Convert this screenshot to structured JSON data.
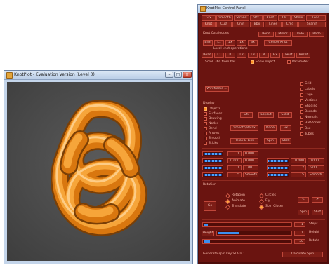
{
  "viewer": {
    "title": "KnotPlot - Evaluation Version (Level 0)",
    "colors": {
      "background": "#4c4c4c",
      "knot": "#e98d1f"
    },
    "controls": [
      "minimize-button",
      "maximize-button",
      "close-button"
    ]
  },
  "panel": {
    "title": "KnotPlot Control Panel",
    "tabs_row1": [
      "Gfx",
      "Smooth",
      "Strand",
      "Vtx",
      "Knot",
      "Clr",
      "Show",
      "Load"
    ],
    "tabs_row2": [
      "Knot",
      "Cust",
      "Cnlit",
      "Bbx",
      "Lines",
      "Cmd",
      "Search"
    ],
    "section_label": "Knot Catalogues",
    "top_buttons": [
      "Bend",
      "Mirror",
      "Undo",
      "Redo"
    ],
    "row_a": [
      "Brm",
      "L1",
      "2x",
      "1x",
      "3x",
      "Center Knot"
    ],
    "row_b_label": "Local knot operations",
    "row_b": [
      "Bead",
      "L1",
      "R",
      "L2",
      "L3",
      "R",
      "Fix",
      "Twist",
      "Reset"
    ],
    "note": "Scroll 360 from bar",
    "check_show_object": "Show object",
    "check_parameter": "Parameter",
    "mode_button": "Wireframe ...",
    "right_checks": [
      "Grid",
      "Labels",
      "Cage",
      "Vertices",
      "Shading",
      "Bounds",
      "Normals",
      "Half-tones",
      "Box",
      "Tubes"
    ],
    "display_label": "Display",
    "left_checks": [
      "Objects",
      "Surfaces",
      "Drawing",
      "Nodes",
      "Bend",
      "Arrows",
      "Smooth",
      "Sticks"
    ],
    "mid_buttons": [
      "Gfx",
      "Layout",
      "Solid",
      "Smooth/Relax",
      "Node",
      "Fix",
      "Relax & Link",
      "Spin",
      "Stick"
    ],
    "fields": {
      "row1": [
        "1",
        "0.000"
      ],
      "row2": [
        "0.000",
        "0.000",
        "0.000",
        "0.000"
      ],
      "row3": [
        "1",
        "1.00",
        "2",
        "5.00"
      ],
      "row4": [
        "5",
        "Smooth",
        "15",
        "Smooth"
      ]
    },
    "radio_label": "Rotation",
    "radios": [
      "Rotation",
      "Animate",
      "Translate",
      "Circles",
      "Fly",
      "Spin Closer"
    ],
    "side_buttons": [
      "<",
      ">",
      "Spin",
      "Shift"
    ],
    "go_button": "Go",
    "bottom_rows": [
      {
        "label": "",
        "value": "1",
        "tag": "Steps"
      },
      {
        "label": "Height",
        "value": "1",
        "tag": "Height"
      },
      {
        "label": "",
        "value": "50",
        "tag": "Rotate"
      }
    ],
    "footer_note": "Generate spin key STATIC ...",
    "footer_button": "Calculate Spin",
    "progress": {
      "slider_a": 0.05,
      "slider_b": 0.3,
      "slider_c": 0.07
    }
  }
}
